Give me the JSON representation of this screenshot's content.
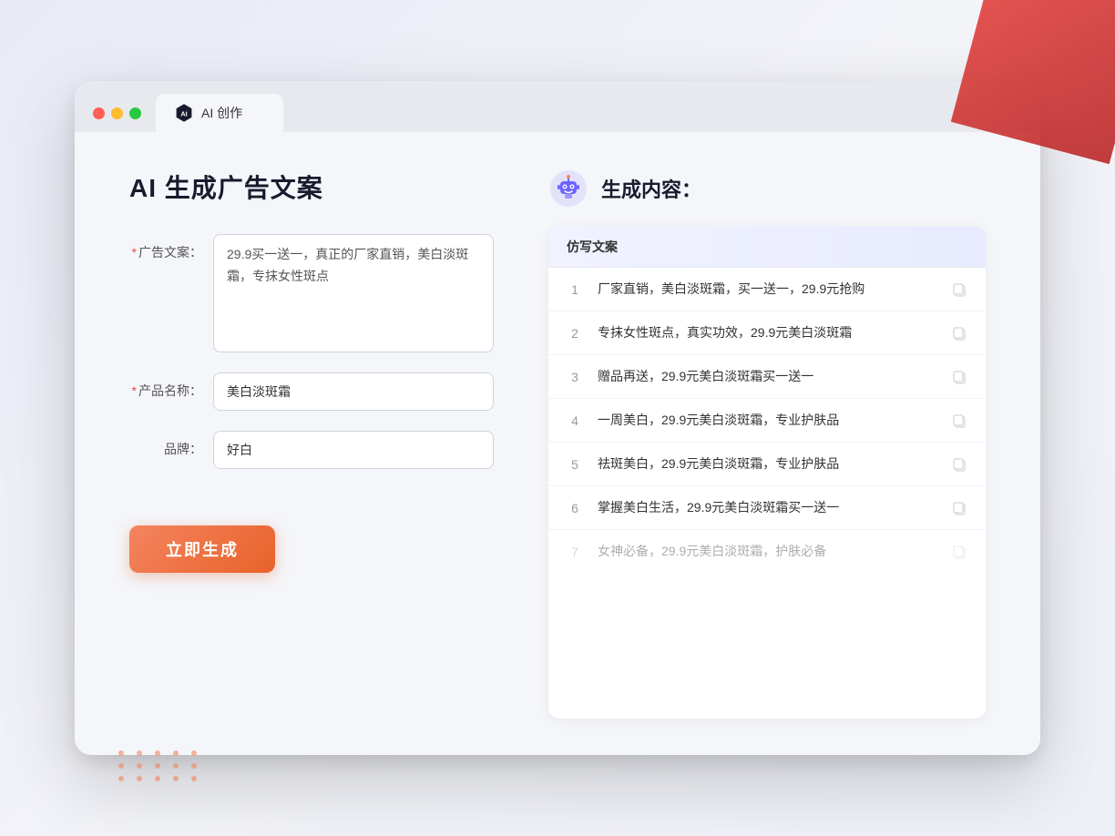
{
  "browser": {
    "tab_title": "AI 创作"
  },
  "page": {
    "title": "AI 生成广告文案"
  },
  "form": {
    "ad_copy_label": "广告文案：",
    "ad_copy_required": "*",
    "ad_copy_value": "29.9买一送一，真正的厂家直销，美白淡斑霜，专抹女性斑点",
    "product_name_label": "产品名称：",
    "product_name_required": "*",
    "product_name_value": "美白淡斑霜",
    "brand_label": "品牌：",
    "brand_value": "好白",
    "generate_button": "立即生成"
  },
  "output": {
    "title": "生成内容：",
    "table_header": "仿写文案",
    "items": [
      {
        "number": "1",
        "text": "厂家直销，美白淡斑霜，买一送一，29.9元抢购"
      },
      {
        "number": "2",
        "text": "专抹女性斑点，真实功效，29.9元美白淡斑霜"
      },
      {
        "number": "3",
        "text": "赠品再送，29.9元美白淡斑霜买一送一"
      },
      {
        "number": "4",
        "text": "一周美白，29.9元美白淡斑霜，专业护肤品"
      },
      {
        "number": "5",
        "text": "祛斑美白，29.9元美白淡斑霜，专业护肤品"
      },
      {
        "number": "6",
        "text": "掌握美白生活，29.9元美白淡斑霜买一送一"
      },
      {
        "number": "7",
        "text": "女神必备，29.9元美白淡斑霜，护肤必备"
      }
    ]
  }
}
